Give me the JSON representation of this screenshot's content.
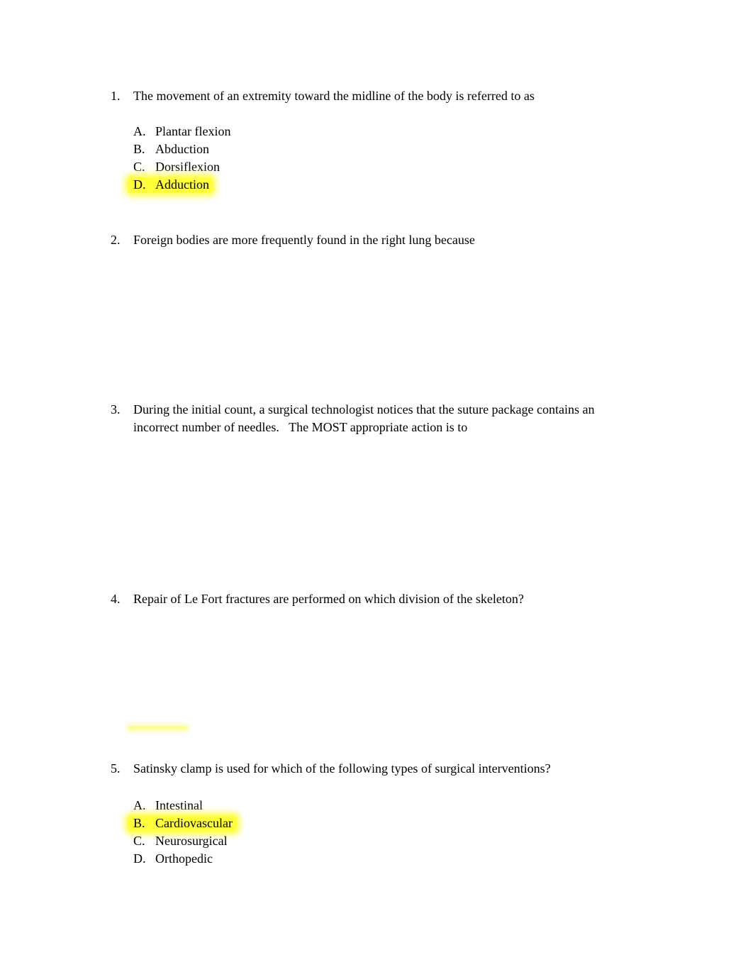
{
  "questions": [
    {
      "number": "1.",
      "text": "The movement of an extremity toward the midline of the body is referred to as",
      "options": [
        {
          "letter": "A.",
          "text": "Plantar flexion"
        },
        {
          "letter": "B.",
          "text": "Abduction"
        },
        {
          "letter": "C.",
          "text": "Dorsiflexion"
        },
        {
          "letter": "D.",
          "text": "Adduction",
          "highlighted": true
        }
      ]
    },
    {
      "number": "2.",
      "text": "Foreign bodies are more frequently found in the right lung because"
    },
    {
      "number": "3.",
      "text": "During the initial count, a surgical technologist notices that the suture package contains an incorrect number of needles.   The MOST appropriate action is to"
    },
    {
      "number": "4.",
      "text": "Repair of Le Fort fractures are performed on which division of the skeleton?"
    },
    {
      "number": "5.",
      "text": "Satinsky clamp is used for which of the following types of surgical interventions?",
      "options": [
        {
          "letter": "A.",
          "text": "Intestinal"
        },
        {
          "letter": "B.",
          "text": "Cardiovascular",
          "highlighted": true
        },
        {
          "letter": "C.",
          "text": "Neurosurgical"
        },
        {
          "letter": "D.",
          "text": "Orthopedic"
        }
      ]
    }
  ],
  "highlight_color": "#ffff3a"
}
